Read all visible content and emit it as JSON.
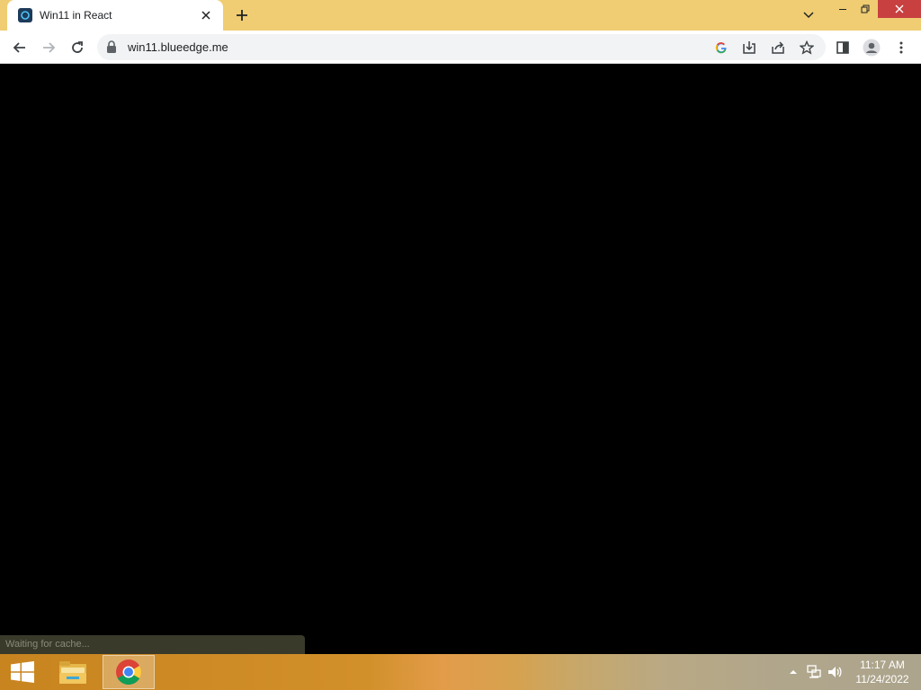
{
  "browser": {
    "tab": {
      "title": "Win11 in React"
    },
    "address": {
      "url": "win11.blueedge.me"
    },
    "colors": {
      "frame": "#f0cd72",
      "close_hover": "#c84040"
    }
  },
  "status": {
    "text": "Waiting for cache..."
  },
  "taskbar": {
    "apps": [
      {
        "name": "File Explorer",
        "icon": "folder-icon"
      },
      {
        "name": "Google Chrome",
        "icon": "chrome-icon",
        "active": true
      }
    ],
    "clock": {
      "time": "11:17 AM",
      "date": "11/24/2022"
    }
  }
}
